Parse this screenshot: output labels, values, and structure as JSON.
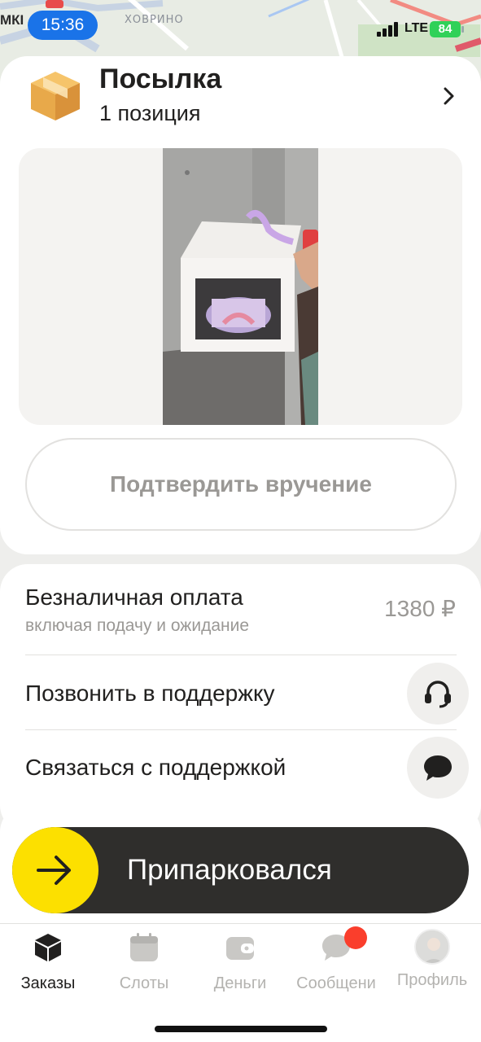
{
  "status_bar": {
    "time": "15:36",
    "network": "LTE",
    "battery": "84"
  },
  "map": {
    "district_label": "ХОВРИНО",
    "road_label": "МКІ"
  },
  "parcel": {
    "title": "Посылка",
    "subtitle": "1 позиция",
    "icon": "package-box-icon"
  },
  "confirm_button": {
    "label": "Подтвердить вручение"
  },
  "payment": {
    "title": "Безналичная оплата",
    "subtitle": "включая подачу и ожидание",
    "amount": "1380 ₽"
  },
  "support": {
    "call_label": "Позвонить в поддержку",
    "call_icon": "headset-icon",
    "chat_label": "Связаться с поддержкой",
    "chat_icon": "chat-bubble-icon"
  },
  "slider": {
    "label": "Припарковался",
    "icon": "arrow-right-icon"
  },
  "tabs": [
    {
      "label": "Заказы",
      "icon": "orders-cube-icon",
      "active": true
    },
    {
      "label": "Слоты",
      "icon": "calendar-icon",
      "active": false
    },
    {
      "label": "Деньги",
      "icon": "wallet-icon",
      "active": false
    },
    {
      "label": "Сообщени",
      "icon": "message-bubble-icon",
      "active": false
    },
    {
      "label": "Профиль",
      "icon": "avatar-icon",
      "active": false
    }
  ],
  "colors": {
    "accent_yellow": "#fce000",
    "slider_dark": "#2f2e2c",
    "notification_red": "#fa3e2c",
    "time_pill_blue": "#1a73e8",
    "battery_green": "#30d158"
  }
}
